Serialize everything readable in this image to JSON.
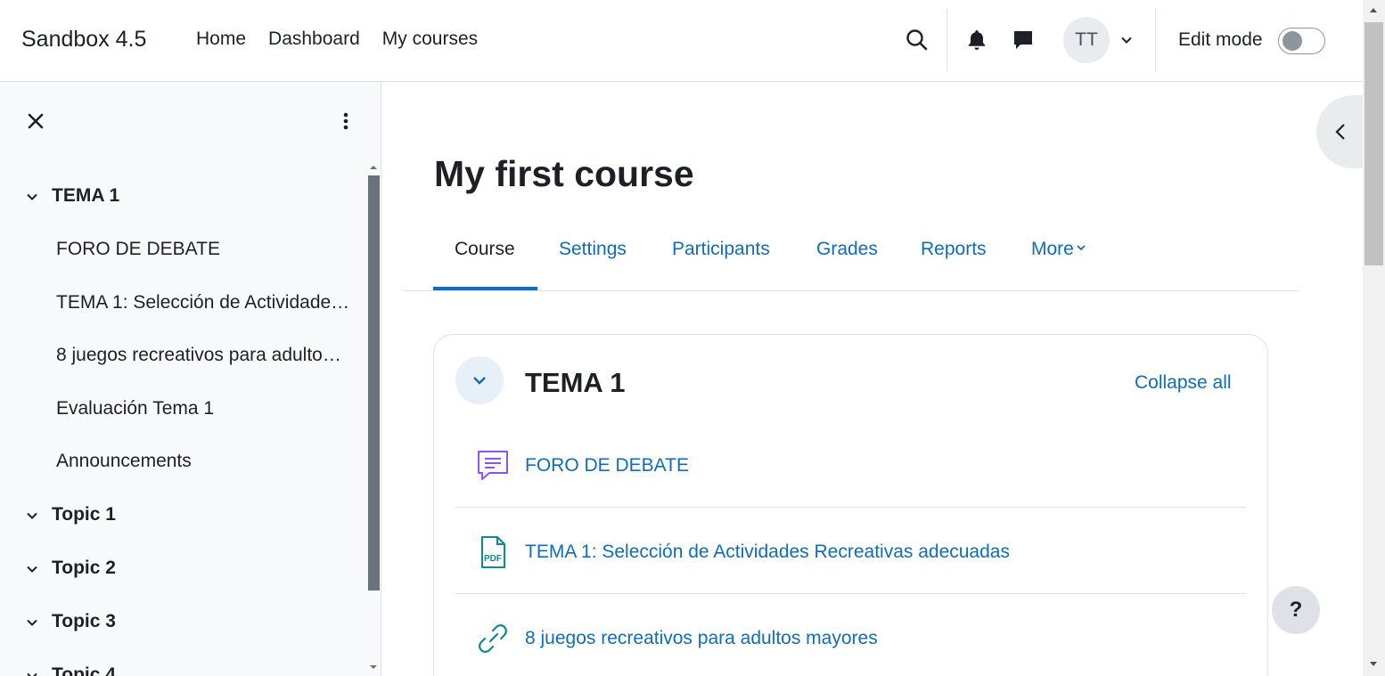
{
  "navbar": {
    "brand": "Sandbox 4.5",
    "links": [
      "Home",
      "Dashboard",
      "My courses"
    ],
    "avatar_initials": "TT",
    "edit_mode_label": "Edit mode",
    "edit_mode_on": false
  },
  "drawer": {
    "sections": [
      {
        "title": "TEMA 1",
        "expanded": true,
        "items": [
          "FORO DE DEBATE",
          "TEMA 1: Selección de Actividades Recreativas adecuadas",
          "8 juegos recreativos para adultos mayores",
          "Evaluación Tema 1",
          "Announcements"
        ]
      },
      {
        "title": "Topic 1",
        "expanded": true,
        "items": []
      },
      {
        "title": "Topic 2",
        "expanded": true,
        "items": []
      },
      {
        "title": "Topic 3",
        "expanded": true,
        "items": []
      },
      {
        "title": "Topic 4",
        "expanded": true,
        "items": []
      }
    ]
  },
  "course": {
    "title": "My first course",
    "tabs": [
      "Course",
      "Settings",
      "Participants",
      "Grades",
      "Reports",
      "More"
    ],
    "active_tab": "Course",
    "section": {
      "title": "TEMA 1",
      "collapse_all": "Collapse all",
      "activities": [
        {
          "name": "FORO DE DEBATE",
          "icon": "forum-icon"
        },
        {
          "name": "TEMA 1: Selección de Actividades Recreativas adecuadas",
          "icon": "pdf-icon"
        },
        {
          "name": "8 juegos recreativos para adultos mayores",
          "icon": "url-link-icon"
        }
      ]
    }
  },
  "help_button": "?",
  "colors": {
    "link": "#0f6cbf",
    "forum_icon": "#8c52ff",
    "resource_icon": "#0d8a92"
  }
}
